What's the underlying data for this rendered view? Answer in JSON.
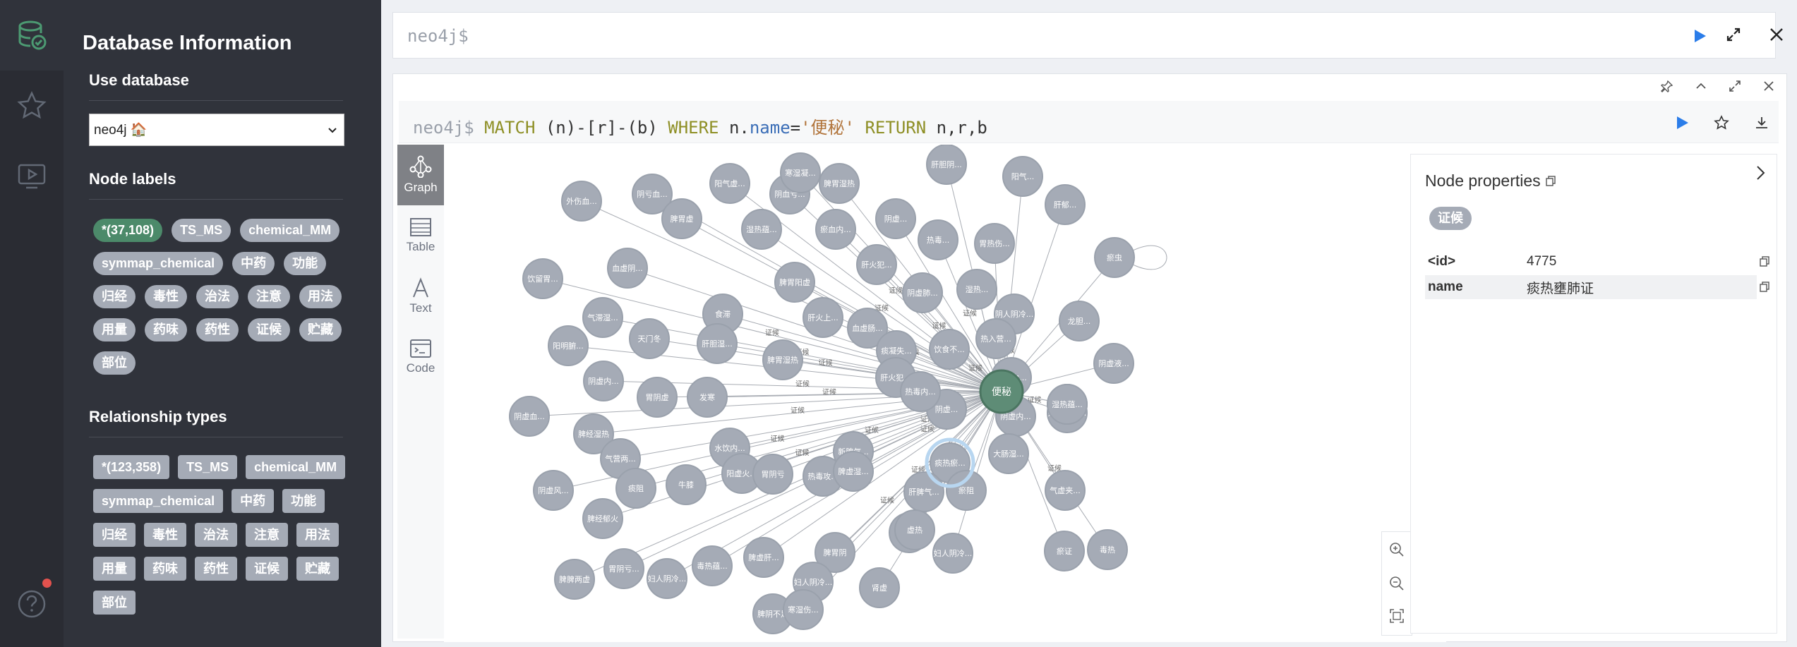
{
  "rail": {
    "icons": [
      "database-icon",
      "star-icon",
      "play-guide-icon",
      "help-icon"
    ]
  },
  "drawer": {
    "title": "Database Information",
    "use_database_title": "Use database",
    "selected_database": "neo4j 🏠",
    "node_labels_title": "Node labels",
    "node_labels": [
      "*(37,108)",
      "TS_MS",
      "chemical_MM",
      "symmap_chemical",
      "中药",
      "功能",
      "归经",
      "毒性",
      "治法",
      "注意",
      "用法",
      "用量",
      "药味",
      "药性",
      "证候",
      "贮藏",
      "部位"
    ],
    "relationship_types_title": "Relationship types",
    "relationship_types": [
      "*(123,358)",
      "TS_MS",
      "chemical_MM",
      "symmap_chemical",
      "中药",
      "功能",
      "归经",
      "毒性",
      "治法",
      "注意",
      "用法",
      "用量",
      "药味",
      "药性",
      "证候",
      "贮藏",
      "部位"
    ]
  },
  "editor": {
    "prompt": "neo4j$"
  },
  "frame": {
    "prompt": "neo4j$",
    "query": {
      "kw1": "MATCH",
      "pattern": " (n)-[r]-(b) ",
      "kw2": "WHERE",
      "prop_obj": " n.",
      "prop_name": "name",
      "eq": "=",
      "str": "'便秘'",
      "kw3": " RETURN",
      "ret": " n,r,b"
    },
    "tabs": {
      "graph": "Graph",
      "table": "Table",
      "text": "Text",
      "code": "Code"
    }
  },
  "graph_data": {
    "center": "便秘",
    "edge_label": "证候",
    "nodes": [
      "外伤血...",
      "阴亏血...",
      "阳气虚...",
      "阴血亏...",
      "寒湿凝...",
      "脾胃湿热",
      "肝胆阴...",
      "阳气...",
      "肝郁...",
      "饮留胃...",
      "血虚阴...",
      "脾胃虚",
      "湿热蕴...",
      "瘀血内...",
      "阴虚...",
      "热毒...",
      "胃热伤...",
      "瘀虫",
      "气滞湿...",
      "食滞",
      "脾胃阳虚",
      "肝火犯...",
      "阴虚肺...",
      "湿热...",
      "阴人阴冷...",
      "龙胆...",
      "阳明腑...",
      "天门冬",
      "肝胆湿...",
      "脾胃湿热",
      "肝火上...",
      "血虚肠...",
      "痰凝失...",
      "饮食不...",
      "热入营...",
      "阴虚液...",
      "阴虚内...",
      "肝火犯...",
      "阴虚...",
      "阴虚内...",
      "脾虚血...",
      "阴虚血...",
      "胃阴虚",
      "发寒",
      "热毒内...",
      "妇人阴冷...",
      "胃阴虚...",
      "湿热蕴...",
      "脾经湿热",
      "气营两...",
      "水饮内...",
      "新脾气...",
      "痰热瘀...",
      "大肠湿...",
      "阴虚风...",
      "痰阻",
      "牛膝",
      "阳虚火...",
      "胃阴亏",
      "热毒攻...",
      "脾虚湿...",
      "肝脾气...",
      "气虚夹...",
      "脾经郁火",
      "瘀阻",
      "胃虚阴",
      "虚热",
      "妇人阴冷...",
      "瘀证",
      "毒热",
      "脾脾两虚",
      "胃阴亏...",
      "妇人阴冷...",
      "毒热蕴...",
      "脾虚肝...",
      "脾胃阴",
      "妇人阴冷...",
      "肾虚",
      "脾阴不足",
      "寒湿伤..."
    ]
  },
  "properties": {
    "title": "Node properties",
    "label": "证候",
    "rows": [
      {
        "key": "<id>",
        "value": "4775"
      },
      {
        "key": "name",
        "value": "痰热壅肺证"
      }
    ]
  }
}
